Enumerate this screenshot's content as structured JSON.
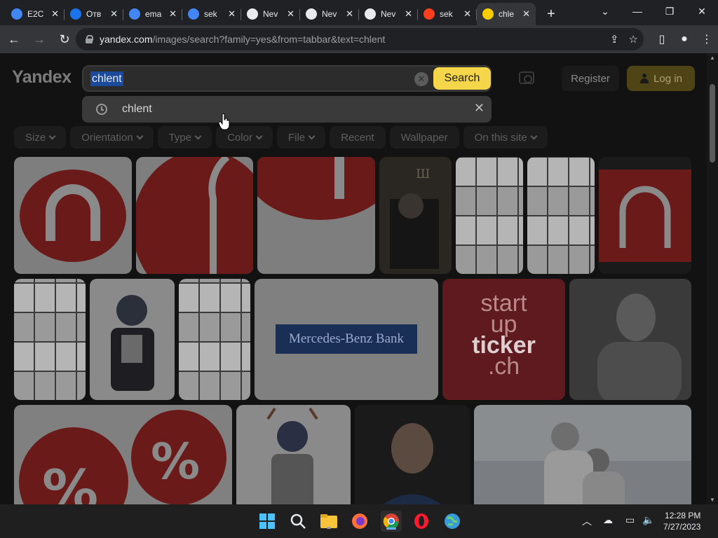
{
  "browser": {
    "tabs": [
      {
        "title": "E2C",
        "favicon": "google-icon",
        "color": "#4285f4"
      },
      {
        "title": "Отв",
        "favicon": "help-icon",
        "color": "#1a73e8"
      },
      {
        "title": "ema",
        "favicon": "google-icon",
        "color": "#4285f4"
      },
      {
        "title": "sek",
        "favicon": "google-icon",
        "color": "#4285f4"
      },
      {
        "title": "Nev",
        "favicon": "chrome-icon",
        "color": "#e8eaed"
      },
      {
        "title": "Nev",
        "favicon": "chrome-icon",
        "color": "#e8eaed"
      },
      {
        "title": "Nev",
        "favicon": "chrome-icon",
        "color": "#e8eaed"
      },
      {
        "title": "sek",
        "favicon": "yandex-icon",
        "color": "#fc3f1d"
      },
      {
        "title": "chle",
        "favicon": "yandex-images-icon",
        "color": "#ffcc00"
      }
    ],
    "url_host": "yandex.com",
    "url_path": "/images/search?family=yes&from=tabbar&text=chlent"
  },
  "yandex": {
    "logo": "Yandex",
    "query": "chlent",
    "search_label": "Search",
    "suggestion": "chlent",
    "register_label": "Register",
    "login_label": "Log in",
    "filters": [
      {
        "label": "Size",
        "dropdown": true
      },
      {
        "label": "Orientation",
        "dropdown": true
      },
      {
        "label": "Type",
        "dropdown": true
      },
      {
        "label": "Color",
        "dropdown": true
      },
      {
        "label": "File",
        "dropdown": true
      },
      {
        "label": "Recent",
        "dropdown": false
      },
      {
        "label": "Wallpaper",
        "dropdown": false
      },
      {
        "label": "On this site",
        "dropdown": true
      }
    ],
    "image_texts": {
      "startup_1": "start",
      "startup_2": "up",
      "startup_3": "ticker",
      "startup_4": ".ch",
      "mercedes": "Mercedes-Benz Bank"
    }
  },
  "taskbar": {
    "time": "12:28 PM",
    "date": "7/27/2023"
  },
  "colors": {
    "search_button": "#f5d64a",
    "login_button": "#4e4416",
    "selection": "#1b4a9a"
  }
}
